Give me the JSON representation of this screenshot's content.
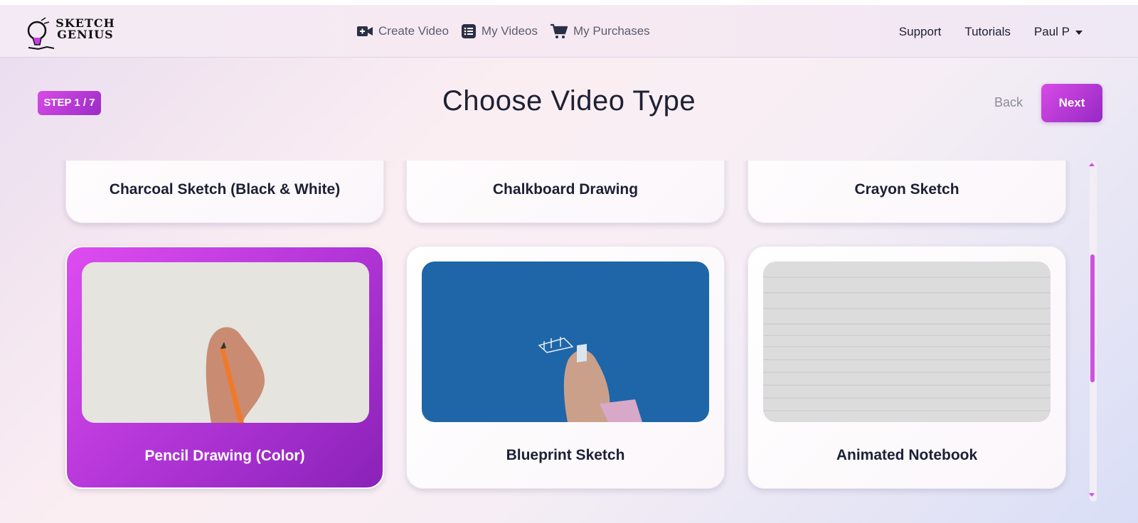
{
  "brand": {
    "logo_text_1": "SKETCH",
    "logo_text_2": "GENIUS"
  },
  "nav": {
    "center": [
      {
        "label": "Create Video",
        "icon": "video-plus-icon"
      },
      {
        "label": "My Videos",
        "icon": "list-icon"
      },
      {
        "label": "My Purchases",
        "icon": "cart-icon"
      }
    ],
    "support": "Support",
    "tutorials": "Tutorials",
    "user": "Paul P"
  },
  "wizard": {
    "step": "STEP 1 / 7",
    "title": "Choose Video Type",
    "back": "Back",
    "next": "Next"
  },
  "video_types": [
    {
      "label": "Charcoal Sketch (Black & White)"
    },
    {
      "label": "Chalkboard Drawing"
    },
    {
      "label": "Crayon Sketch"
    },
    {
      "label": "Pencil Drawing (Color)",
      "selected": true
    },
    {
      "label": "Blueprint Sketch"
    },
    {
      "label": "Animated Notebook"
    }
  ],
  "colors": {
    "accent": "#c73fe0",
    "blueprint": "#1e66a8",
    "text_dark": "#1c2036"
  }
}
